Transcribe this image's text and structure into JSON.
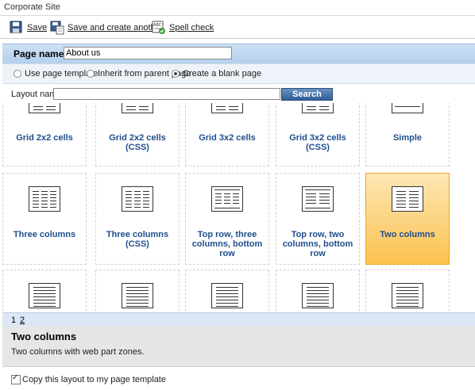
{
  "window_title": "Corporate Site",
  "toolbar": {
    "save_label": "Save",
    "save_create_label": "Save and create another",
    "spell_check_label": "Spell check"
  },
  "page_name": {
    "label": "Page name:",
    "value": "About us"
  },
  "options": {
    "use_template": "Use page template",
    "inherit": "Inherit from parent page",
    "blank": "Create a blank page",
    "selected": "blank"
  },
  "layout_search": {
    "label": "Layout name:",
    "value": "",
    "button": "Search"
  },
  "layouts": [
    {
      "name": "Grid 2x2 cells",
      "thumb": "grid"
    },
    {
      "name": "Grid 2x2 cells (CSS)",
      "thumb": "grid"
    },
    {
      "name": "Grid 3x2 cells",
      "thumb": "grid"
    },
    {
      "name": "Grid 3x2 cells (CSS)",
      "thumb": "grid"
    },
    {
      "name": "Simple",
      "thumb": "simple"
    },
    {
      "name": "Three columns",
      "thumb": "three"
    },
    {
      "name": "Three columns (CSS)",
      "thumb": "three"
    },
    {
      "name": "Top row, three columns, bottom row",
      "thumb": "top-three"
    },
    {
      "name": "Top row, two columns, bottom row",
      "thumb": "top-two"
    },
    {
      "name": "Two columns",
      "thumb": "two",
      "selected": true
    },
    {
      "name": "",
      "thumb": "lines"
    },
    {
      "name": "",
      "thumb": "lines"
    },
    {
      "name": "",
      "thumb": "lines"
    },
    {
      "name": "",
      "thumb": "lines"
    },
    {
      "name": "",
      "thumb": "lines"
    }
  ],
  "pager": {
    "page1": "1",
    "page2": "2"
  },
  "selected_detail": {
    "title": "Two columns",
    "description": "Two columns with web part zones."
  },
  "copy_checkbox": {
    "label": "Copy this layout to my page template",
    "checked": true
  }
}
